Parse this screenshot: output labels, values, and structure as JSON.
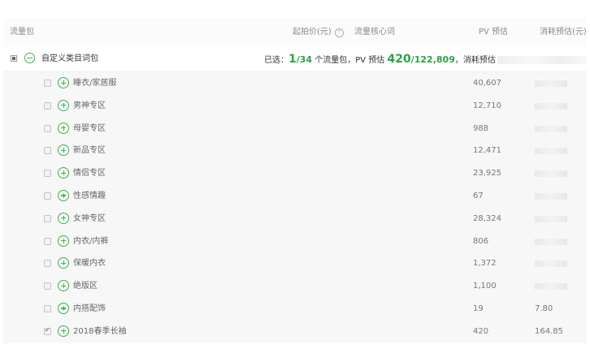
{
  "header": {
    "col_name": "流量包",
    "col_bid": "起拍价(元)",
    "col_bid_help_icon": "question-circle-icon",
    "col_keyword": "流量核心词",
    "col_pv": "PV 预估",
    "col_cost": "消耗预估(元)"
  },
  "group": {
    "name": "自定义类目词包",
    "selected_prefix": "已选：",
    "selected_count": "1",
    "selected_total": "/34",
    "selected_suffix": " 个流量包，PV 预估 ",
    "pv_selected": "420",
    "pv_total": "/122,809",
    "cost_prefix": "，消耗预估"
  },
  "colors": {
    "accent_green": "#3ab54a",
    "highlight_green": "#2aa344"
  },
  "rows": [
    {
      "name": "睡衣/家居服",
      "pv": "40,607",
      "cost": "",
      "checked": false
    },
    {
      "name": "男神专区",
      "pv": "12,710",
      "cost": "",
      "checked": false
    },
    {
      "name": "母婴专区",
      "pv": "988",
      "cost": "",
      "checked": false
    },
    {
      "name": "新品专区",
      "pv": "12,471",
      "cost": "",
      "checked": false
    },
    {
      "name": "情侣专区",
      "pv": "23,925",
      "cost": "",
      "checked": false
    },
    {
      "name": "性感情趣",
      "pv": "67",
      "cost": "",
      "checked": false
    },
    {
      "name": "女神专区",
      "pv": "28,324",
      "cost": "",
      "checked": false
    },
    {
      "name": "内衣/内裤",
      "pv": "806",
      "cost": "",
      "checked": false
    },
    {
      "name": "保暖内衣",
      "pv": "1,372",
      "cost": "",
      "checked": false
    },
    {
      "name": "绝版区",
      "pv": "1,100",
      "cost": "",
      "checked": false
    },
    {
      "name": "内搭配饰",
      "pv": "19",
      "cost": "7.80",
      "checked": false
    },
    {
      "name": "2018春季长袖",
      "pv": "420",
      "cost": "164.85",
      "checked": true
    }
  ]
}
